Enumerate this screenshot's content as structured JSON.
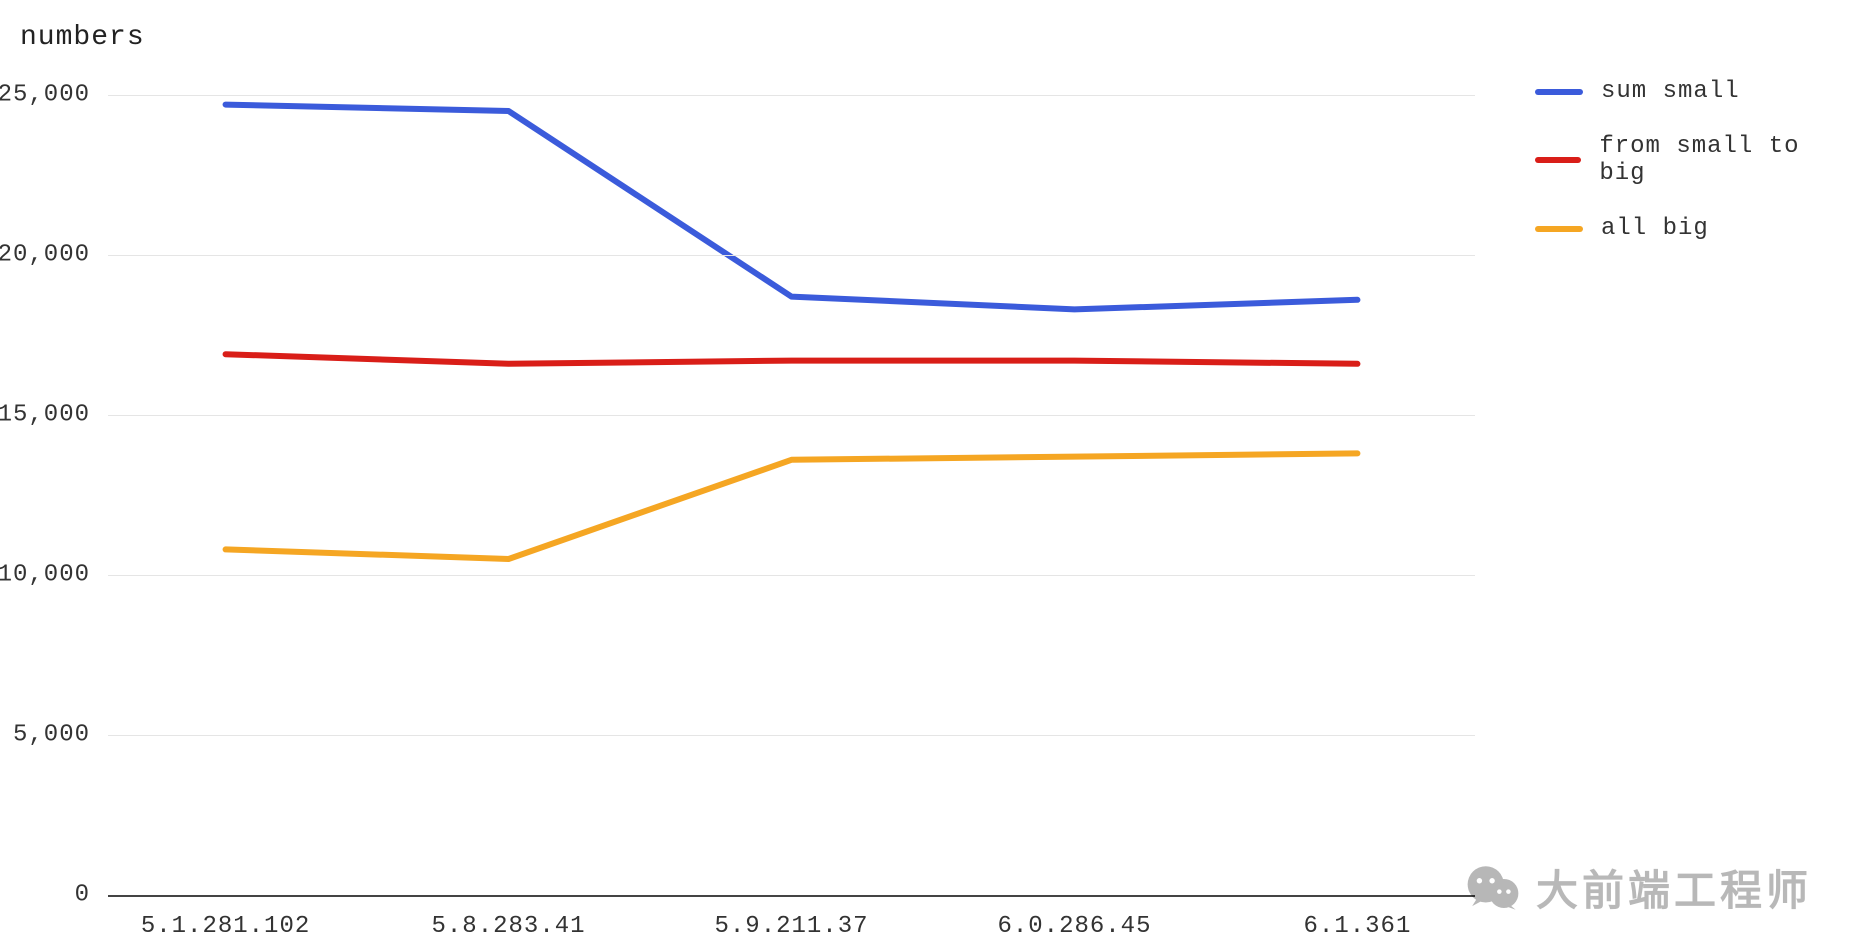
{
  "title": "numbers",
  "watermark": "大前端工程师",
  "legend": {
    "items": [
      {
        "name": "sum small",
        "color": "#3b5bdb"
      },
      {
        "name": "from small to big",
        "color": "#d91e18"
      },
      {
        "name": "all big",
        "color": "#f5a623"
      }
    ]
  },
  "chart_data": {
    "type": "line",
    "xlabel": "",
    "ylabel": "",
    "title": "numbers",
    "categories": [
      "5.1.281.102",
      "5.8.283.41",
      "5.9.211.37",
      "6.0.286.45",
      "6.1.361"
    ],
    "series": [
      {
        "name": "sum small",
        "color": "#3b5bdb",
        "values": [
          24700,
          24500,
          18700,
          18300,
          18600
        ]
      },
      {
        "name": "from small to big",
        "color": "#d91e18",
        "values": [
          16900,
          16600,
          16700,
          16700,
          16600
        ]
      },
      {
        "name": "all big",
        "color": "#f5a623",
        "values": [
          10800,
          10500,
          13600,
          13700,
          13800
        ]
      }
    ],
    "yticks": [
      0,
      5000,
      10000,
      15000,
      20000,
      25000
    ],
    "ylim": [
      0,
      25000
    ]
  },
  "colors": {
    "grid": "#e5e5e5",
    "axis": "#444444"
  }
}
